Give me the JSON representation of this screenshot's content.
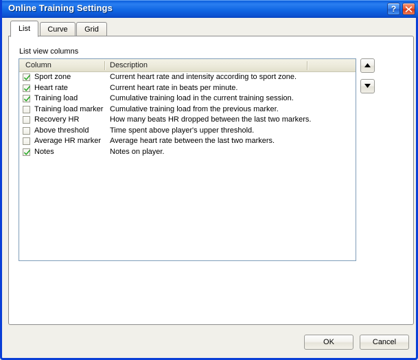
{
  "window": {
    "title": "Online Training Settings",
    "help_button": "?",
    "close_button": "close-icon"
  },
  "tabs": [
    {
      "label": "List",
      "active": true
    },
    {
      "label": "Curve",
      "active": false
    },
    {
      "label": "Grid",
      "active": false
    }
  ],
  "panel": {
    "group_label": "List view columns",
    "list_headers": [
      "Column",
      "Description"
    ],
    "rows": [
      {
        "checked": true,
        "name": "Sport zone",
        "description": "Current heart rate and intensity according to sport zone."
      },
      {
        "checked": true,
        "name": "Heart rate",
        "description": "Current heart rate in beats per minute."
      },
      {
        "checked": true,
        "name": "Training load",
        "description": "Cumulative training load in the current training session."
      },
      {
        "checked": false,
        "name": "Training load marker",
        "description": "Cumulative training load from the previous marker."
      },
      {
        "checked": false,
        "name": "Recovery HR",
        "description": "How many beats HR dropped between the last two markers."
      },
      {
        "checked": false,
        "name": "Above threshold",
        "description": "Time spent above player's upper threshold."
      },
      {
        "checked": false,
        "name": "Average HR marker",
        "description": "Average heart rate between the last two markers."
      },
      {
        "checked": true,
        "name": "Notes",
        "description": "Notes on player."
      }
    ],
    "move_up": "move-up-arrow",
    "move_down": "move-down-arrow"
  },
  "footer": {
    "ok_label": "OK",
    "cancel_label": "Cancel"
  },
  "colors": {
    "titlebar": "#1268e4",
    "checkmark": "#1ba31b",
    "list_header": "#eceadb",
    "list_border": "#7f9db9"
  }
}
